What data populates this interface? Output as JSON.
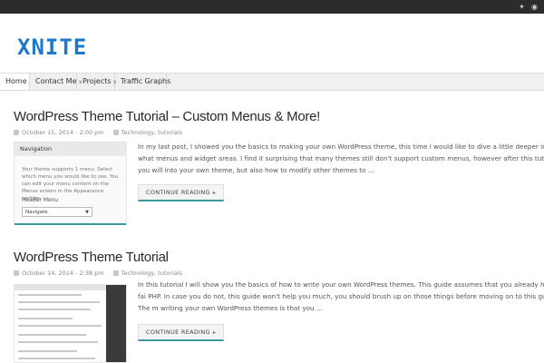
{
  "site": {
    "logo_text": "XNITE"
  },
  "topbar": {
    "icons": [
      "twitter-icon",
      "reddit-icon"
    ]
  },
  "nav": {
    "items": [
      {
        "label": "Home",
        "active": true
      },
      {
        "label": "Contact Me",
        "has_submenu": true
      },
      {
        "label": "Projects",
        "has_submenu": true
      },
      {
        "label": "Traffic Graphs"
      }
    ]
  },
  "posts": [
    {
      "title": "WordPress Theme Tutorial – Custom Menus & More!",
      "date": "October 15, 2014 - 2:00 pm",
      "categories": "Technology, tutorials",
      "excerpt": "In my last post, I showed you the basics to making your own WordPress theme, this time I would like to dive a little deeper into what menus and widget areas. I find it surprising that many themes still don't support custom menus, however after this tutorial you will into your own theme, but also how to modify other themes to …",
      "button": "CONTINUE READING",
      "thumb": {
        "heading": "Navigation",
        "text": "Your theme supports 1 menu. Select which menu you would like to use. You can edit your menu content on the Menus screen in the Appearance section.",
        "menu_label": "Header Menu",
        "select_value": "Navigate"
      }
    },
    {
      "title": "WordPress Theme Tutorial",
      "date": "October 14, 2014 - 2:38 pm",
      "categories": "Technology, tutorials",
      "excerpt": "In this tutorial I will show you the basics of how to write your own WordPress themes. This guide assumes that you already have a fai PHP. In case you do not, this guide won't help you much, you should brush up on those things before moving on to this guide. The m writing your own WordPress themes is that you …",
      "button": "CONTINUE READING"
    }
  ],
  "colors": {
    "accent": "#3a9a9a",
    "logo": "#1e78c8",
    "topbar": "#2c2c2c"
  }
}
